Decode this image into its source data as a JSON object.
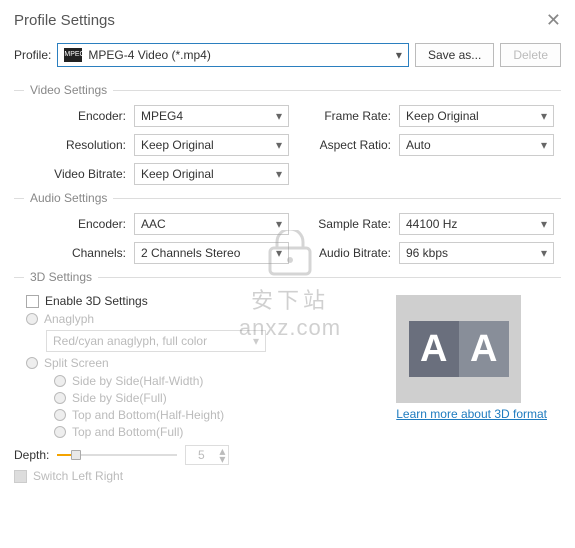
{
  "header": {
    "title": "Profile Settings"
  },
  "profile": {
    "label": "Profile:",
    "icon_tag": "MPEG",
    "value": "MPEG-4 Video (*.mp4)",
    "save_as": "Save as...",
    "delete": "Delete"
  },
  "video": {
    "section": "Video Settings",
    "encoder_lbl": "Encoder:",
    "encoder_val": "MPEG4",
    "resolution_lbl": "Resolution:",
    "resolution_val": "Keep Original",
    "bitrate_lbl": "Video Bitrate:",
    "bitrate_val": "Keep Original",
    "framerate_lbl": "Frame Rate:",
    "framerate_val": "Keep Original",
    "aspect_lbl": "Aspect Ratio:",
    "aspect_val": "Auto"
  },
  "audio": {
    "section": "Audio Settings",
    "encoder_lbl": "Encoder:",
    "encoder_val": "AAC",
    "channels_lbl": "Channels:",
    "channels_val": "2 Channels Stereo",
    "samplerate_lbl": "Sample Rate:",
    "samplerate_val": "44100 Hz",
    "bitrate_lbl": "Audio Bitrate:",
    "bitrate_val": "96 kbps"
  },
  "threeD": {
    "section": "3D Settings",
    "enable": "Enable 3D Settings",
    "anaglyph": "Anaglyph",
    "anaglyph_mode": "Red/cyan anaglyph, full color",
    "split": "Split Screen",
    "sbs_half": "Side by Side(Half-Width)",
    "sbs_full": "Side by Side(Full)",
    "tab_half": "Top and Bottom(Half-Height)",
    "tab_full": "Top and Bottom(Full)",
    "depth_lbl": "Depth:",
    "depth_val": "5",
    "switch": "Switch Left Right",
    "preview_a": "A",
    "preview_b": "A",
    "link": "Learn more about 3D format"
  },
  "watermark": {
    "top": "安下站",
    "bottom": "anxz.com"
  }
}
